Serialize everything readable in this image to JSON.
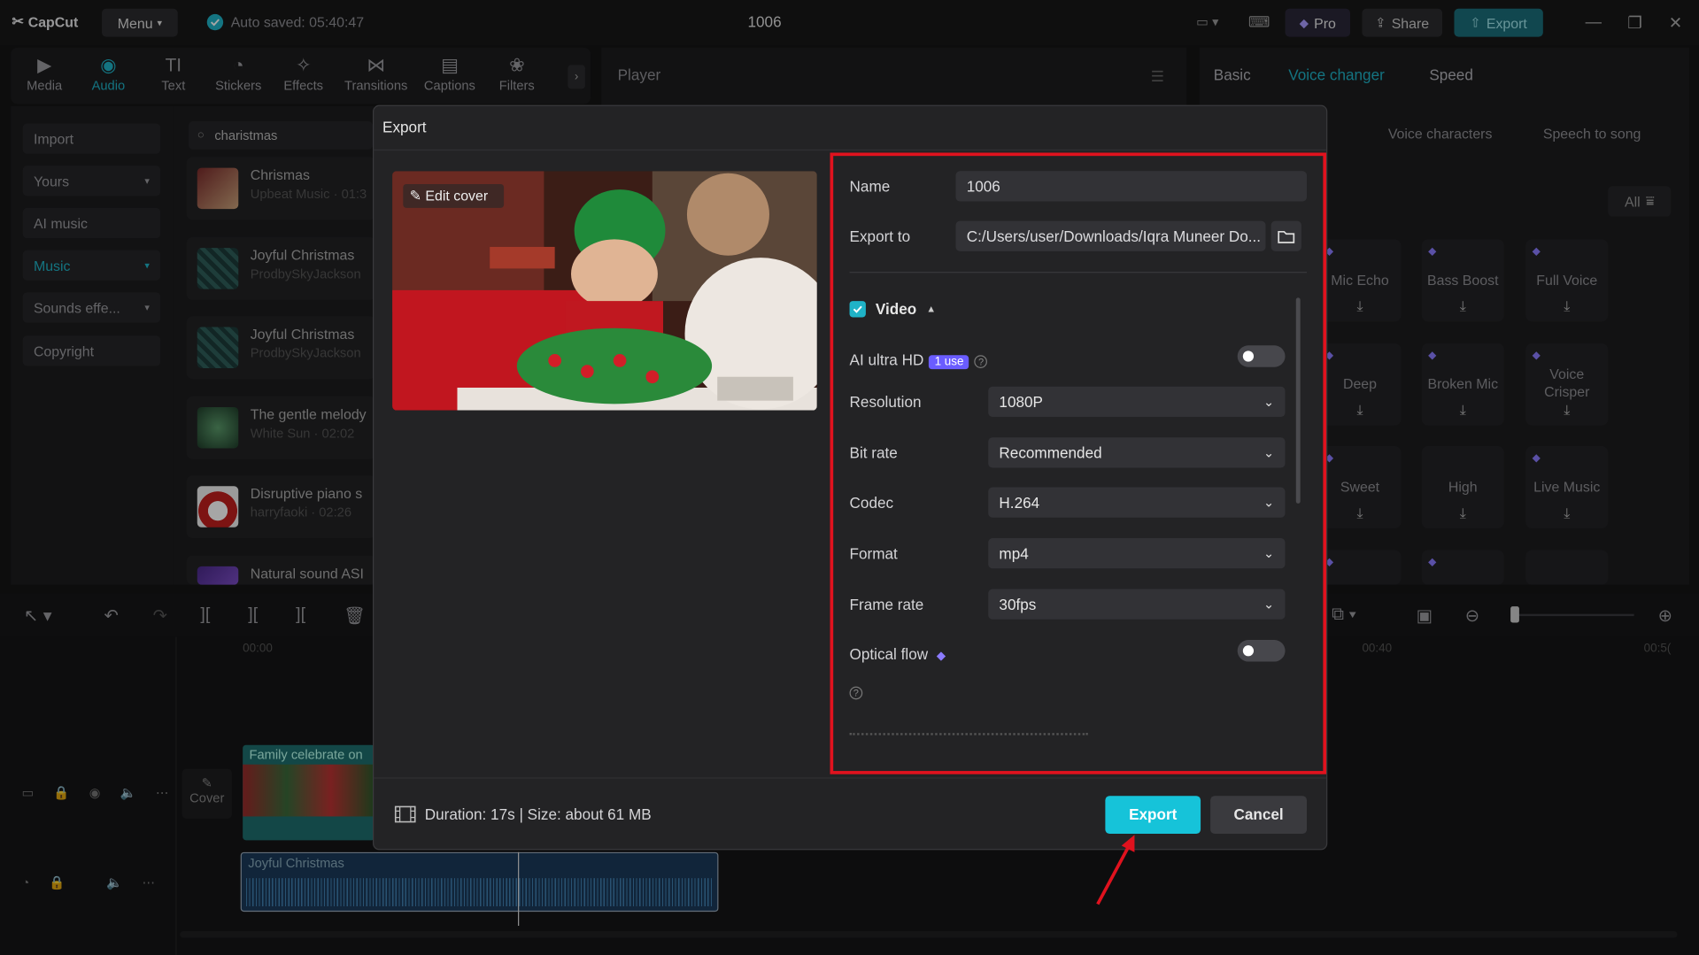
{
  "app": {
    "brand": "CapCut",
    "menu_label": "Menu",
    "autosave": "Auto saved: 05:40:47",
    "project_title": "1006"
  },
  "topbar": {
    "pro_label": "Pro",
    "share_label": "Share",
    "export_label": "Export"
  },
  "toolbar": {
    "tools": [
      {
        "label": "Media",
        "icon": "media-icon"
      },
      {
        "label": "Audio",
        "icon": "audio-icon",
        "active": true
      },
      {
        "label": "Text",
        "icon": "text-icon"
      },
      {
        "label": "Stickers",
        "icon": "stickers-icon"
      },
      {
        "label": "Effects",
        "icon": "effects-icon"
      },
      {
        "label": "Transitions",
        "icon": "transitions-icon"
      },
      {
        "label": "Captions",
        "icon": "captions-icon"
      },
      {
        "label": "Filters",
        "icon": "filters-icon"
      }
    ]
  },
  "sidebar": {
    "items": [
      {
        "label": "Import"
      },
      {
        "label": "Yours"
      },
      {
        "label": "AI music"
      },
      {
        "label": "Music",
        "active": true
      },
      {
        "label": "Sounds effe..."
      },
      {
        "label": "Copyright"
      }
    ]
  },
  "library": {
    "search_value": "charistmas",
    "tracks": [
      {
        "title": "Chrismas",
        "sub": "Upbeat Music · 01:3"
      },
      {
        "title": "Joyful Christmas",
        "sub": "ProdbySkyJackson"
      },
      {
        "title": "Joyful Christmas",
        "sub": "ProdbySkyJackson"
      },
      {
        "title": "The gentle melody",
        "sub": "White Sun · 02:02"
      },
      {
        "title": "Disruptive piano s",
        "sub": "harryfaoki · 02:26"
      },
      {
        "title": "Natural sound ASI",
        "sub": ""
      }
    ]
  },
  "player": {
    "label": "Player"
  },
  "right_panel": {
    "tabs": [
      "Basic",
      "Voice changer",
      "Speed"
    ],
    "subtabs": [
      "Voice characters",
      "Speech to song"
    ],
    "filter_label": "All",
    "voices": [
      "Mic Echo",
      "Bass Boost",
      "Full Voice",
      "Deep",
      "Broken Mic",
      "Voice Crisper",
      "Sweet",
      "High",
      "Live Music"
    ]
  },
  "timeline": {
    "times": [
      "00:00",
      "00:40",
      "00:5("
    ],
    "video_clip_label": "Family celebrate on",
    "cover_label": "Cover",
    "audio_clip_label": "Joyful Christmas"
  },
  "dialog": {
    "title": "Export",
    "edit_cover": "Edit cover",
    "name_label": "Name",
    "name_value": "1006",
    "export_to_label": "Export to",
    "export_to_value": "C:/Users/user/Downloads/Iqra Muneer Do...",
    "video_label": "Video",
    "ai_hd_label": "AI ultra HD",
    "ai_hd_badge": "1 use",
    "resolution_label": "Resolution",
    "resolution_value": "1080P",
    "bitrate_label": "Bit rate",
    "bitrate_value": "Recommended",
    "codec_label": "Codec",
    "codec_value": "H.264",
    "format_label": "Format",
    "format_value": "mp4",
    "framerate_label": "Frame rate",
    "framerate_value": "30fps",
    "optical_flow_label": "Optical flow",
    "duration_text": "Duration: 17s | Size: about 61 MB",
    "export_button": "Export",
    "cancel_button": "Cancel"
  },
  "colors": {
    "accent": "#1fb3c7",
    "highlight_box": "#e0121e",
    "export_button": "#16c3d9",
    "premium": "#6a5cff"
  }
}
